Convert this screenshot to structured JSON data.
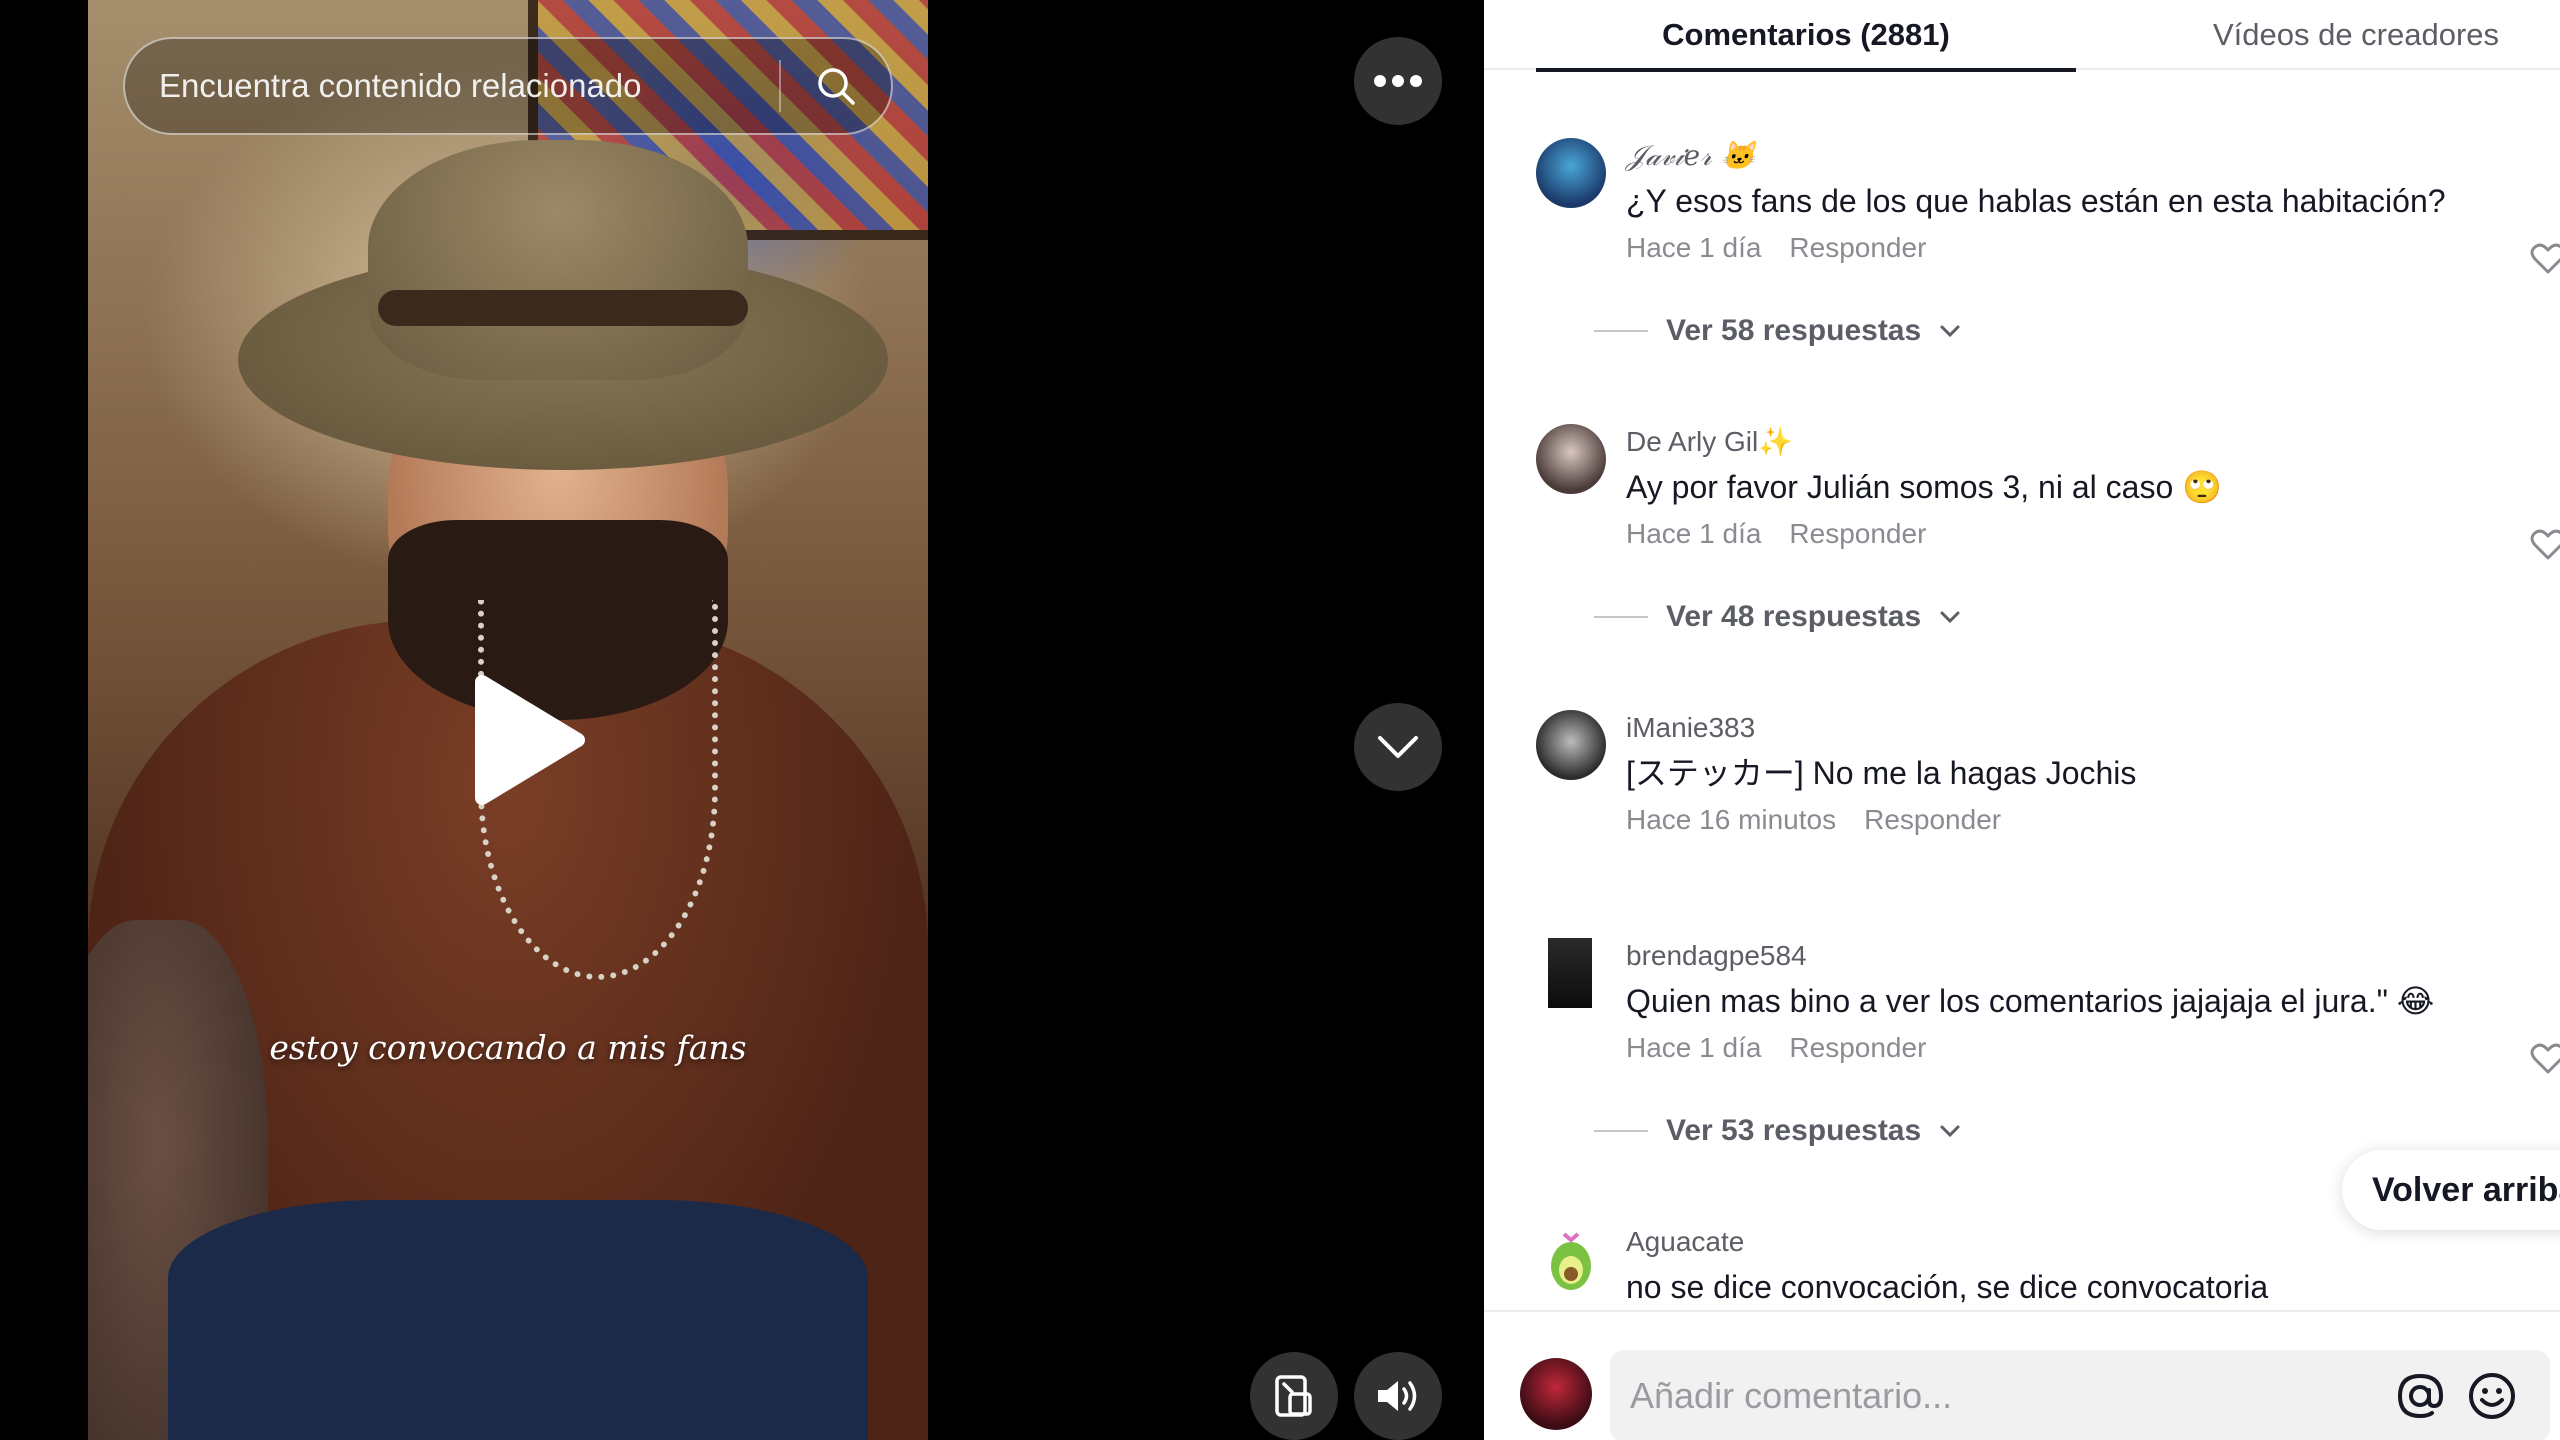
{
  "video": {
    "search_placeholder": "Encuentra contenido relacionado",
    "caption": "estoy convocando a mis fans"
  },
  "tabs": {
    "comments": "Comentarios (2881)",
    "creator_videos": "Vídeos de creadores"
  },
  "comments": [
    {
      "user": "𝒥𝒶𝓋𝒾𝑒𝓇 🐱",
      "text": "¿Y esos fans de los que hablas están en esta habitación?",
      "time": "Hace 1 día",
      "reply": "Responder",
      "replies": "Ver 58 respuestas"
    },
    {
      "user": "De Arly Gil✨",
      "text": "Ay por favor Julián somos 3, ni al caso 🙄",
      "time": "Hace 1 día",
      "reply": "Responder",
      "replies": "Ver 48 respuestas"
    },
    {
      "user": "iManie383",
      "text": "[ステッカー] No me la hagas Jochis",
      "time": "Hace 16 minutos",
      "reply": "Responder"
    },
    {
      "user": "brendagpe584",
      "text": "Quien mas bino a ver los comentarios jajajaja el jura.\" 😂",
      "time": "Hace 1 día",
      "reply": "Responder",
      "replies": "Ver 53 respuestas"
    },
    {
      "user": "Aguacate",
      "text": "no se dice convocación, se dice convocatoria"
    }
  ],
  "back_to_top": "Volver arriba",
  "composer": {
    "placeholder": "Añadir comentario..."
  },
  "colors": {
    "accent_text": "#161823",
    "muted_text": "#8a8b91",
    "panel_bg": "#ffffff"
  }
}
